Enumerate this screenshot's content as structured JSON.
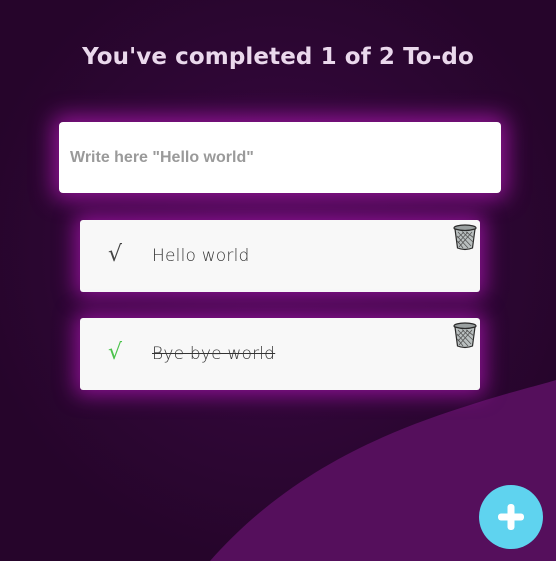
{
  "header": {
    "completed_text": "You've completed 1 of 2 To-do"
  },
  "input": {
    "placeholder": "Write here \"Hello world\"",
    "value": ""
  },
  "todos": [
    {
      "text": "Hello world",
      "check_glyph": "√",
      "completed": false,
      "delete_icon": "trash-icon"
    },
    {
      "text": "Bye bye world",
      "check_glyph": "√",
      "completed": true,
      "delete_icon": "trash-icon"
    }
  ],
  "fab": {
    "icon": "plus-icon",
    "color": "#5fd3ef"
  },
  "colors": {
    "background": "#2b0632",
    "wave": "#550f5c",
    "glow": "#b018b4",
    "check_done": "#4cc34c"
  }
}
